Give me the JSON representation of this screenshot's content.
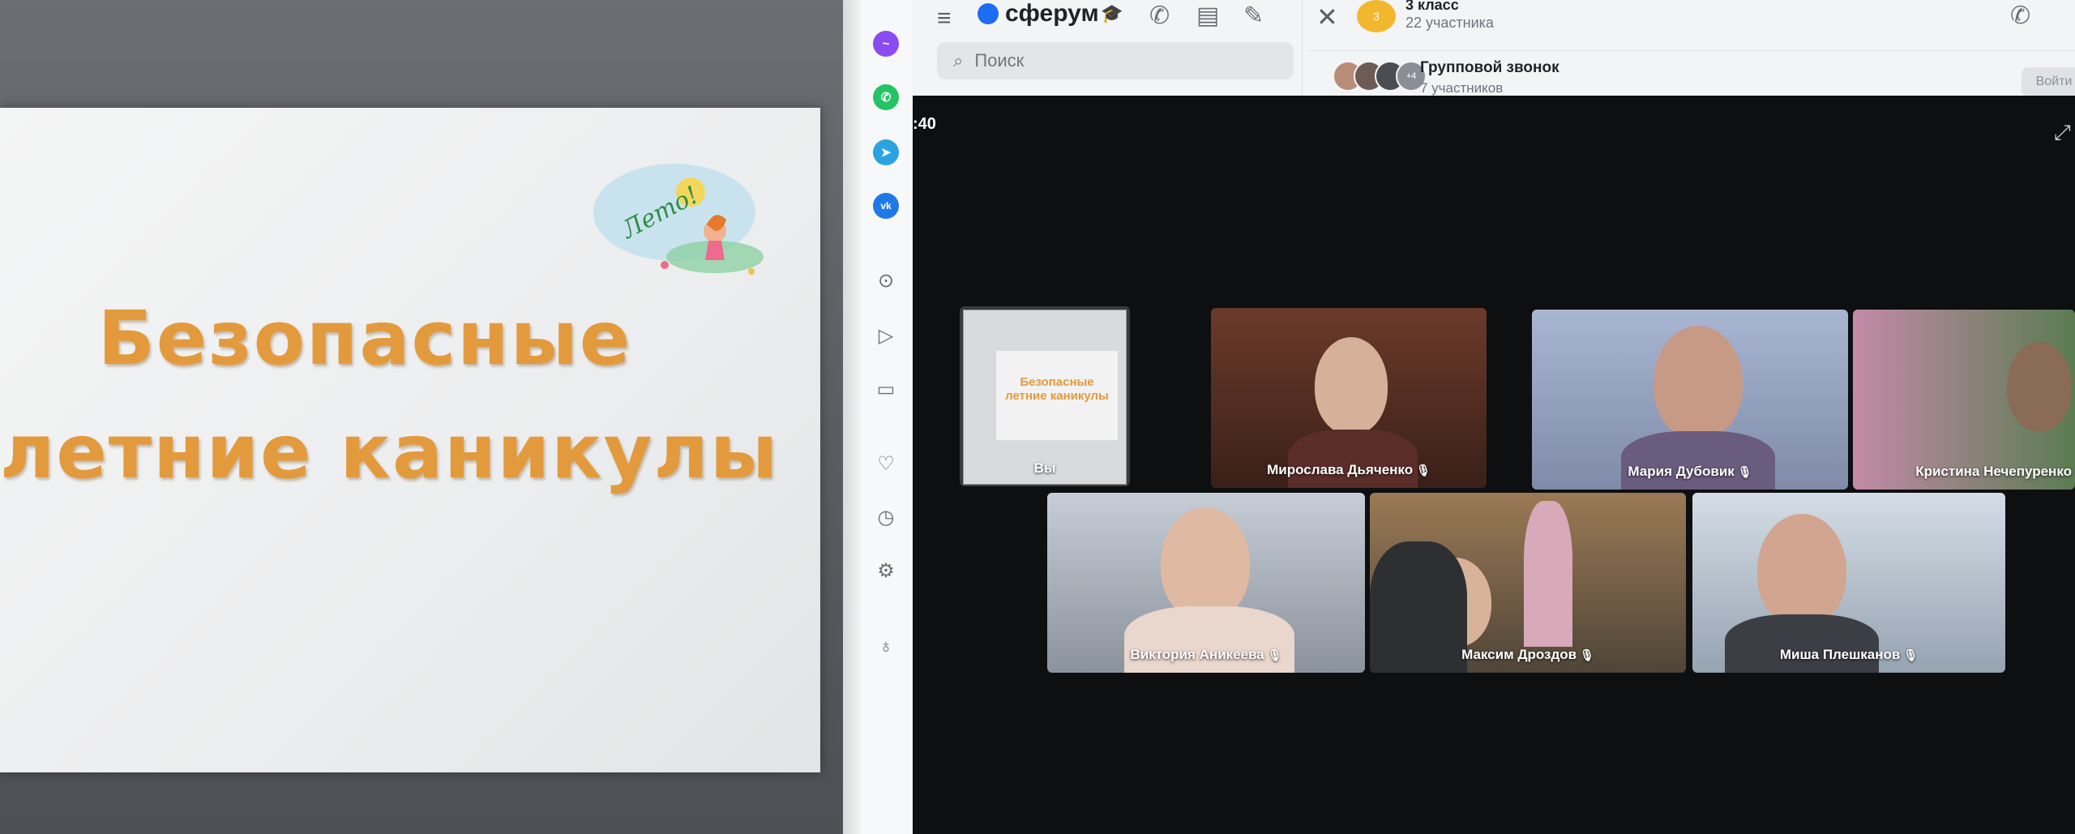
{
  "slide": {
    "title_line1": "Безопасные",
    "title_line2": "летние  каникулы",
    "logo_text": "Лето!"
  },
  "sidebar": {
    "icons": [
      "messenger-icon",
      "whatsapp-icon",
      "telegram-icon",
      "vk-icon",
      "play-icon",
      "send-icon",
      "wallet-icon",
      "heart-icon",
      "clock-icon",
      "gear-icon",
      "bulb-icon"
    ]
  },
  "app": {
    "brand": "сферум",
    "search_placeholder": "Поиск",
    "chat": {
      "avatar_text": "3",
      "title": "3 класс",
      "subtitle": "22 участника"
    },
    "call": {
      "title": "Групповой звонок",
      "subtitle": "7 участников",
      "avatar_more": "+4",
      "join_label": "Войти"
    },
    "timer": ":40"
  },
  "participants": [
    {
      "name": "Вы"
    },
    {
      "name": "Мирослава Дьяченко"
    },
    {
      "name": "Мария Дубовик"
    },
    {
      "name": "Кристина Нечепуренко"
    },
    {
      "name": "Виктория Аникеева"
    },
    {
      "name": "Максим Дроздов"
    },
    {
      "name": "Миша Плешканов"
    }
  ],
  "colors": {
    "accent": "#1d6df2",
    "slide_title": "#e39a3d",
    "video_bg": "#0e0f11"
  }
}
